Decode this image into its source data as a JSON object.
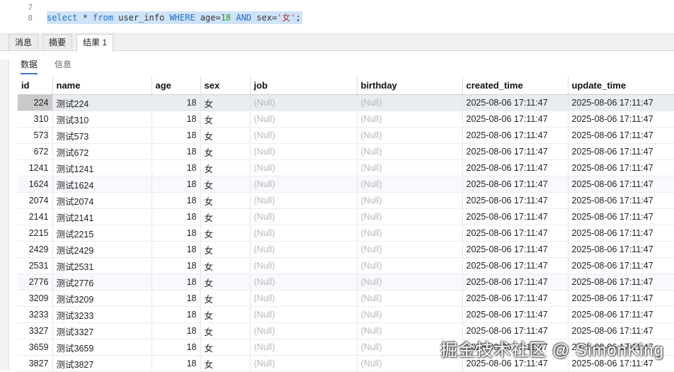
{
  "editor": {
    "line_numbers": [
      "7",
      "8"
    ],
    "sql": {
      "select": "select",
      "star": " * ",
      "from": "from",
      "table": " user_info ",
      "where": "WHERE",
      "cond1": " age=",
      "age_value": "18",
      "and": " AND",
      "cond2": " sex=",
      "sex_value": "'女'",
      "end": ";"
    }
  },
  "tabs": [
    {
      "label": "消息",
      "active": false
    },
    {
      "label": "摘要",
      "active": false
    },
    {
      "label": "结果 1",
      "active": true
    }
  ],
  "subtabs": [
    {
      "label": "数据",
      "active": true
    },
    {
      "label": "信息",
      "active": false
    }
  ],
  "grid": {
    "columns": [
      "id",
      "name",
      "age",
      "sex",
      "job",
      "birthday",
      "created_time",
      "update_time"
    ],
    "rows": [
      [
        "224",
        "测试224",
        "18",
        "女",
        "(Null)",
        "(Null)",
        "2025-08-06 17:11:47",
        "2025-08-06 17:11:47"
      ],
      [
        "310",
        "测试310",
        "18",
        "女",
        "(Null)",
        "(Null)",
        "2025-08-06 17:11:47",
        "2025-08-06 17:11:47"
      ],
      [
        "573",
        "测试573",
        "18",
        "女",
        "(Null)",
        "(Null)",
        "2025-08-06 17:11:47",
        "2025-08-06 17:11:47"
      ],
      [
        "672",
        "测试672",
        "18",
        "女",
        "(Null)",
        "(Null)",
        "2025-08-06 17:11:47",
        "2025-08-06 17:11:47"
      ],
      [
        "1241",
        "测试1241",
        "18",
        "女",
        "(Null)",
        "(Null)",
        "2025-08-06 17:11:47",
        "2025-08-06 17:11:47"
      ],
      [
        "1624",
        "测试1624",
        "18",
        "女",
        "(Null)",
        "(Null)",
        "2025-08-06 17:11:47",
        "2025-08-06 17:11:47"
      ],
      [
        "2074",
        "测试2074",
        "18",
        "女",
        "(Null)",
        "(Null)",
        "2025-08-06 17:11:47",
        "2025-08-06 17:11:47"
      ],
      [
        "2141",
        "测试2141",
        "18",
        "女",
        "(Null)",
        "(Null)",
        "2025-08-06 17:11:47",
        "2025-08-06 17:11:47"
      ],
      [
        "2215",
        "测试2215",
        "18",
        "女",
        "(Null)",
        "(Null)",
        "2025-08-06 17:11:47",
        "2025-08-06 17:11:47"
      ],
      [
        "2429",
        "测试2429",
        "18",
        "女",
        "(Null)",
        "(Null)",
        "2025-08-06 17:11:47",
        "2025-08-06 17:11:47"
      ],
      [
        "2531",
        "测试2531",
        "18",
        "女",
        "(Null)",
        "(Null)",
        "2025-08-06 17:11:47",
        "2025-08-06 17:11:47"
      ],
      [
        "2776",
        "测试2776",
        "18",
        "女",
        "(Null)",
        "(Null)",
        "2025-08-06 17:11:47",
        "2025-08-06 17:11:47"
      ],
      [
        "3209",
        "测试3209",
        "18",
        "女",
        "(Null)",
        "(Null)",
        "2025-08-06 17:11:47",
        "2025-08-06 17:11:47"
      ],
      [
        "3233",
        "测试3233",
        "18",
        "女",
        "(Null)",
        "(Null)",
        "2025-08-06 17:11:47",
        "2025-08-06 17:11:47"
      ],
      [
        "3327",
        "测试3327",
        "18",
        "女",
        "(Null)",
        "(Null)",
        "2025-08-06 17:11:47",
        "2025-08-06 17:11:47"
      ],
      [
        "3659",
        "测试3659",
        "18",
        "女",
        "(Null)",
        "(Null)",
        "2025-08-06 17:11:47",
        "2025-08-06 17:11:47"
      ],
      [
        "3827",
        "测试3827",
        "18",
        "女",
        "(Null)",
        "(Null)",
        "2025-08-06 17:11:47",
        "2025-08-06 17:11:47"
      ]
    ]
  },
  "watermark": "掘金技术社区 @ SimonKing"
}
